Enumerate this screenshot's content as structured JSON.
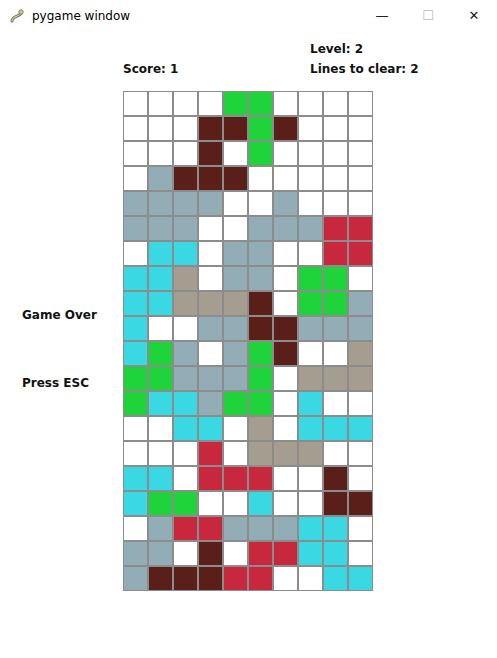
{
  "window": {
    "title": "pygame window",
    "controls": [
      "—",
      "☐",
      "✕"
    ]
  },
  "hud": {
    "score": "Score: 1",
    "level": "Level: 2",
    "lines": "Lines to clear: 2"
  },
  "messages": [
    "Game Over",
    "Press ESC"
  ],
  "board": {
    "palette": {
      ".": "#ffffff",
      "G": "#1fd43a",
      "D": "#5a1f18",
      "B": "#93adb7",
      "C": "#39d8e2",
      "R": "#c8283e",
      "T": "#a59d90"
    },
    "rows": [
      "....GG....",
      "...DDGD...",
      "...D.G....",
      ".BDDD.....",
      "BBBB..B...",
      "BBB..BBBRR",
      ".CC.BB..RR",
      "CCT.BB.GG.",
      "CCTTTD.GGB",
      "C..BBDDBBB",
      "CGB.BGD..T",
      "GGBBBG.TTT",
      "GCCBGG.C..",
      "..CC.T.CCC",
      "...R.TTT..",
      "CC.RRR..D.",
      "CGG..C..DD",
      ".BRRBBBCC.",
      "BB.D.RRCC.",
      "BDDDRR..CC"
    ]
  }
}
